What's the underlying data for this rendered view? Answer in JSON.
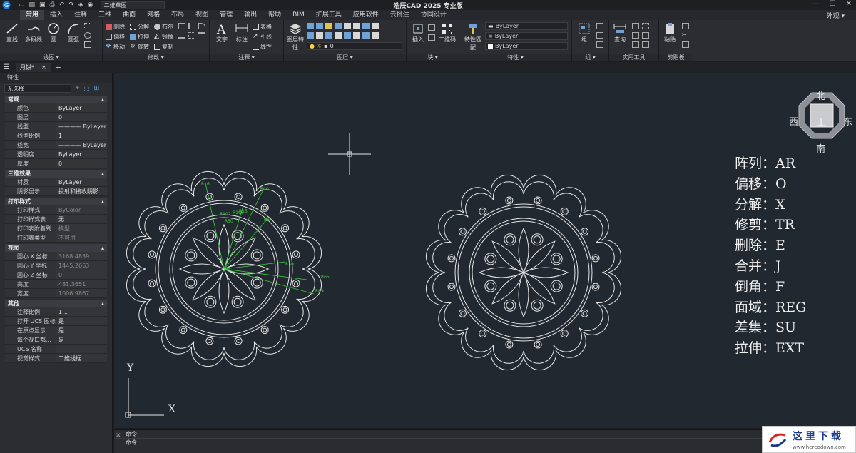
{
  "app": {
    "title": "浩辰CAD 2025 专业版",
    "workspace": "二维草图"
  },
  "menu": {
    "items": [
      "常用",
      "插入",
      "注释",
      "三维",
      "曲面",
      "网格",
      "布局",
      "视图",
      "管理",
      "输出",
      "帮助",
      "BIM",
      "扩展工具",
      "应用软件",
      "云批注",
      "协同设计"
    ],
    "active_index": 0,
    "right": "外观"
  },
  "ribbon": {
    "draw": {
      "label": "绘图",
      "line": "直线",
      "polyline": "多段线",
      "circle": "圆",
      "arc": "圆弧"
    },
    "modify": {
      "label": "修改",
      "erase": "删除",
      "explode": "分解",
      "boolean": "布尔",
      "offset": "偏移",
      "stretch": "拉伸",
      "mirror": "镜像",
      "move": "移动",
      "rotate": "旋转",
      "copy": "复制"
    },
    "annotation": {
      "label": "注释",
      "text": "文字",
      "dim": "标注",
      "table": "表格",
      "leader": "引线",
      "linetype": "线性"
    },
    "layer": {
      "label": "图层",
      "props": "图层特性",
      "current": "0"
    },
    "block": {
      "label": "块",
      "insert": "插入",
      "qrcode": "二维码"
    },
    "properties": {
      "label": "特性",
      "match": "特性匹配",
      "bylayer": "ByLayer"
    },
    "group": {
      "label": "组",
      "group": "组"
    },
    "utilities": {
      "label": "实用工具",
      "query": "查询"
    },
    "clipboard": {
      "label": "剪贴板",
      "paste": "粘贴"
    }
  },
  "doc_tab": {
    "name": "月饼*",
    "close": "×"
  },
  "props_panel": {
    "title": "特性",
    "selection": "无选择",
    "sections": [
      {
        "name": "常规",
        "rows": [
          {
            "k": "颜色",
            "v": "ByLayer"
          },
          {
            "k": "图层",
            "v": "0"
          },
          {
            "k": "线型",
            "v": "———— ByLayer"
          },
          {
            "k": "线型比例",
            "v": "1"
          },
          {
            "k": "线宽",
            "v": "———— ByLayer"
          },
          {
            "k": "透明度",
            "v": "ByLayer"
          },
          {
            "k": "厚度",
            "v": "0"
          }
        ]
      },
      {
        "name": "三维效果",
        "rows": [
          {
            "k": "材质",
            "v": "ByLayer"
          },
          {
            "k": "阴影显示",
            "v": "投射和接收阴影"
          }
        ]
      },
      {
        "name": "打印样式",
        "rows": [
          {
            "k": "打印样式",
            "v": "ByColor",
            "dim": true
          },
          {
            "k": "打印样式表",
            "v": "无"
          },
          {
            "k": "打印表附着到",
            "v": "模型",
            "dim": true
          },
          {
            "k": "打印表类型",
            "v": "不可用",
            "dim": true
          }
        ]
      },
      {
        "name": "视图",
        "rows": [
          {
            "k": "圆心 X 坐标",
            "v": "3168.4839",
            "dim": true
          },
          {
            "k": "圆心 Y 坐标",
            "v": "1445.2663",
            "dim": true
          },
          {
            "k": "圆心 Z 坐标",
            "v": "0",
            "dim": true
          },
          {
            "k": "高度",
            "v": "481.3651",
            "dim": true
          },
          {
            "k": "宽度",
            "v": "1006.9867",
            "dim": true
          }
        ]
      },
      {
        "name": "其他",
        "rows": [
          {
            "k": "注释比例",
            "v": "1:1"
          },
          {
            "k": "打开 UCS 图标",
            "v": "是"
          },
          {
            "k": "在原点显示 ...",
            "v": "是"
          },
          {
            "k": "每个视口都...",
            "v": "是"
          },
          {
            "k": "UCS 名称",
            "v": ""
          },
          {
            "k": "视觉样式",
            "v": "二维线框"
          }
        ]
      }
    ]
  },
  "viewcube": {
    "north": "北",
    "south": "南",
    "east": "东",
    "west": "西",
    "top": "上"
  },
  "ucs": {
    "x": "X",
    "y": "Y"
  },
  "shortcuts": [
    "阵列：AR",
    "偏移：O",
    "分解：X",
    "修剪：TR",
    "删除：E",
    "合并：J",
    "倒角：F",
    "面域：REG",
    "差集：SU",
    "拉伸：EXT"
  ],
  "dimension_labels": [
    "R16",
    "R20",
    "R15",
    "R8",
    "R30",
    "R65",
    "R69",
    "R106",
    "R102",
    "R50"
  ],
  "command": {
    "line1": "命令:",
    "line2": "命令:"
  },
  "watermark": {
    "title": "这里下载",
    "url": "www.hereodown.com"
  },
  "colors": {
    "canvas": "#212830",
    "dim_green": "#3fd13f",
    "drawing": "#e6e6e6"
  }
}
